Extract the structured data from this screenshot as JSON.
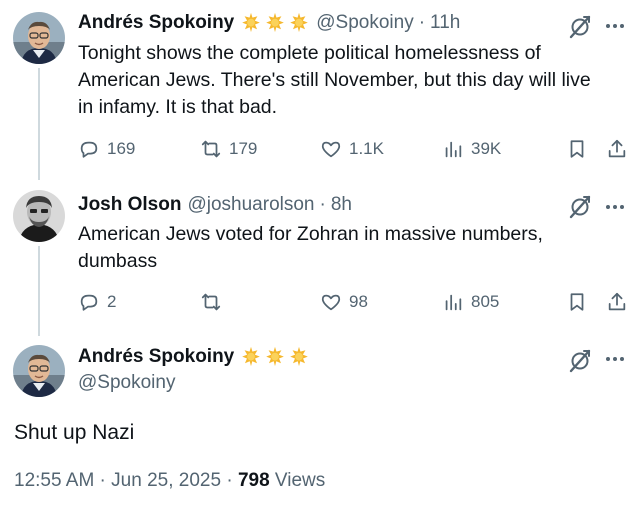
{
  "tweets": [
    {
      "name": "Andrés Spokoiny",
      "handle": "@Spokoiny",
      "time": "11h",
      "lines": [
        "Tonight shows the complete political homelessness of",
        "American Jews. There's still November, but this day will live",
        "in infamy. It is that bad."
      ],
      "stats": {
        "replies": "169",
        "reposts": "179",
        "likes": "1.1K",
        "views": "39K"
      }
    },
    {
      "name": "Josh Olson",
      "handle": "@joshuarolson",
      "time": "8h",
      "lines": [
        "American Jews voted for Zohran in massive numbers,",
        "dumbass"
      ],
      "stats": {
        "replies": "2",
        "reposts": "",
        "likes": "98",
        "views": "805"
      }
    }
  ],
  "main_tweet": {
    "name": "Andrés Spokoiny",
    "handle": "@Spokoiny",
    "text": "Shut up Nazi",
    "time_date": "12:55 AM · Jun 25, 2025",
    "sep": "·",
    "views_count": "798",
    "views_label": "Views"
  },
  "separator": "·",
  "icons": {
    "reply": "reply-icon",
    "repost": "repost-icon",
    "like": "heart-icon",
    "views": "views-chart-icon",
    "bookmark": "bookmark-icon",
    "share": "share-icon",
    "grok": "grok-icon",
    "more": "more-icon",
    "badge": "star-badge-icon"
  },
  "colors": {
    "text": "#0f1419",
    "secondary": "#536471",
    "thread_line": "#cfd9de",
    "star": "#f5b82e"
  }
}
